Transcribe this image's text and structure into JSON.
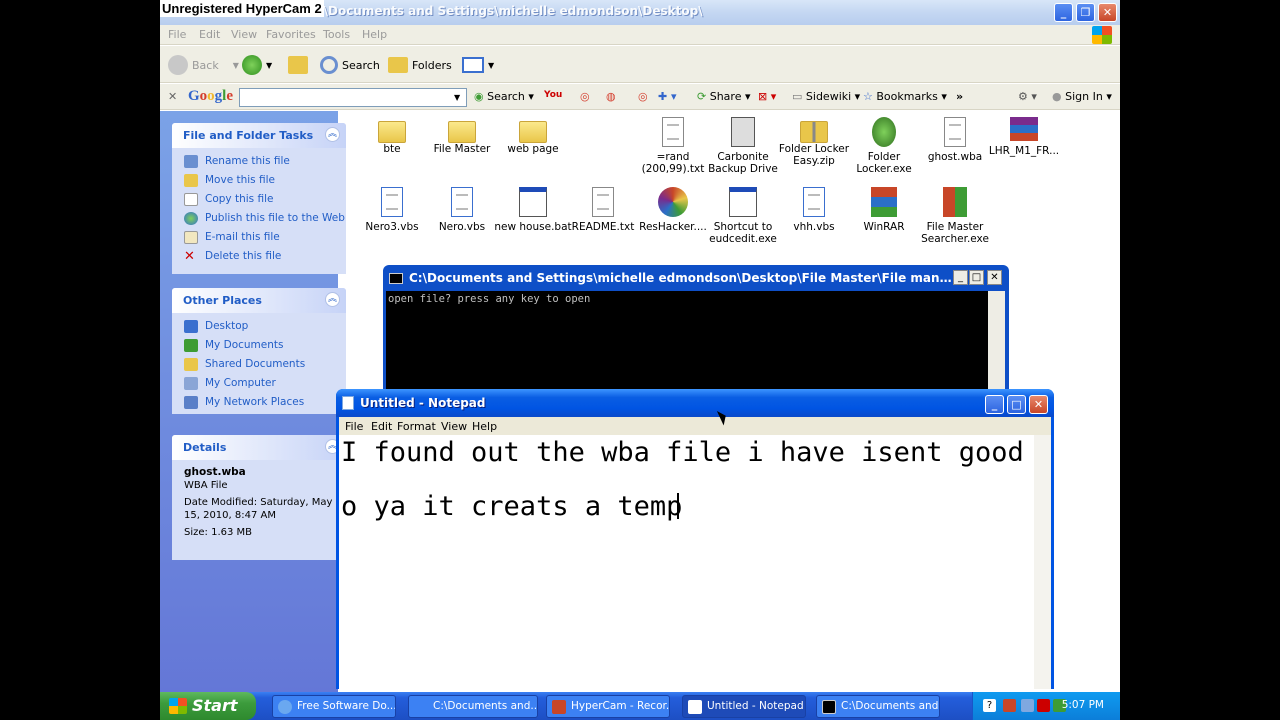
{
  "overlay": {
    "hypercam": "Unregistered HyperCam 2"
  },
  "explorer": {
    "title": "C:\\Documents and Settings\\michelle edmondson\\Desktop\\",
    "menu": [
      "File",
      "Edit",
      "View",
      "Favorites",
      "Tools",
      "Help"
    ],
    "toolbar": {
      "back": "Back",
      "search": "Search",
      "folders": "Folders"
    },
    "google_bar": {
      "logo": "Google",
      "search_label": "Search",
      "share": "Share",
      "sidewiki": "Sidewiki",
      "bookmarks": "Bookmarks",
      "sign_in": "Sign In"
    },
    "tasks_panel": {
      "title": "File and Folder Tasks",
      "items": [
        "Rename this file",
        "Move this file",
        "Copy this file",
        "Publish this file to the Web",
        "E-mail this file",
        "Delete this file"
      ]
    },
    "places_panel": {
      "title": "Other Places",
      "items": [
        "Desktop",
        "My Documents",
        "Shared Documents",
        "My Computer",
        "My Network Places"
      ]
    },
    "details_panel": {
      "title": "Details",
      "name": "ghost.wba",
      "type": "WBA File",
      "modified": "Date Modified: Saturday, May 15, 2010, 8:47 AM",
      "size": "Size: 1.63 MB"
    },
    "files": [
      {
        "label": "bte",
        "kind": "folder"
      },
      {
        "label": "File Master",
        "kind": "folder"
      },
      {
        "label": "web page",
        "kind": "folder"
      },
      {
        "label": "=rand (200,99).txt",
        "kind": "doc"
      },
      {
        "label": "Carbonite Backup Drive",
        "kind": "app"
      },
      {
        "label": "Folder Locker Easy.zip",
        "kind": "zip"
      },
      {
        "label": "Folder Locker.exe",
        "kind": "app"
      },
      {
        "label": "ghost.wba",
        "kind": "doc"
      },
      {
        "label": "LHR_M1_FR...",
        "kind": "rar"
      },
      {
        "label": "Nero3.vbs",
        "kind": "script"
      },
      {
        "label": "Nero.vbs",
        "kind": "script"
      },
      {
        "label": "new house.bat",
        "kind": "bat"
      },
      {
        "label": "README.txt",
        "kind": "doc"
      },
      {
        "label": "ResHacker....",
        "kind": "app"
      },
      {
        "label": "Shortcut to eudcedit.exe",
        "kind": "app"
      },
      {
        "label": "vhh.vbs",
        "kind": "script"
      },
      {
        "label": "WinRAR",
        "kind": "rar"
      },
      {
        "label": "File Master Searcher.exe",
        "kind": "app"
      }
    ]
  },
  "console": {
    "title": "C:\\Documents and Settings\\michelle edmondson\\Desktop\\File Master\\File manger opener....",
    "text": "open file? press any key to open"
  },
  "notepad": {
    "title": "Untitled - Notepad",
    "menu": [
      "File",
      "Edit",
      "Format",
      "View",
      "Help"
    ],
    "lines": [
      "I found out the wba file i have isent good",
      "o ya it creats a temp"
    ]
  },
  "taskbar": {
    "start": "Start",
    "tasks": [
      "Free Software Do...",
      "C:\\Documents and...",
      "HyperCam - Recor...",
      "Untitled - Notepad",
      "C:\\Documents and..."
    ],
    "clock": "5:07 PM"
  }
}
